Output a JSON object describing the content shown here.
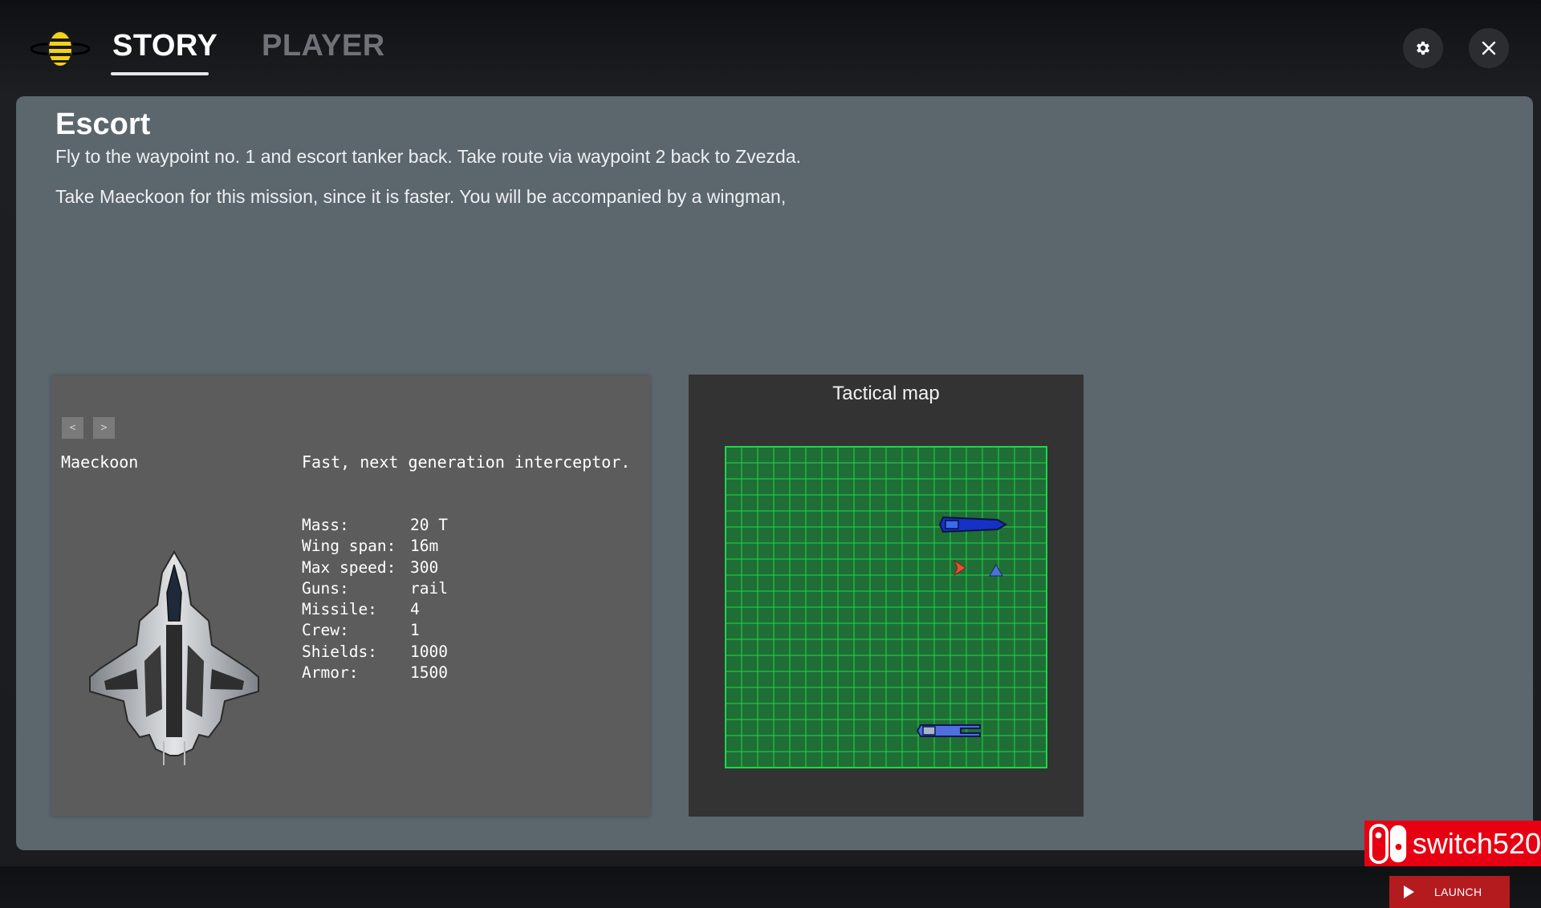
{
  "tabs": [
    {
      "label": "STORY",
      "active": true
    },
    {
      "label": "PLAYER",
      "active": false
    }
  ],
  "header": {
    "logo_icon": "bee-icon",
    "settings_icon": "gear-icon",
    "close_icon": "close-icon"
  },
  "mission": {
    "title": "Escort",
    "description_lines": [
      "Fly to the waypoint no. 1 and escort tanker back. Take route via waypoint 2 back to Zvezda.",
      "Take Maeckoon for this mission, since it is faster. You will be accompanied by a wingman,"
    ]
  },
  "ship": {
    "nav_prev": "<",
    "nav_next": ">",
    "name": "Maeckoon",
    "tagline": "Fast, next generation interceptor.",
    "stats": [
      {
        "label": "Mass:",
        "value": "20 T"
      },
      {
        "label": "Wing span:",
        "value": "16m"
      },
      {
        "label": "Max speed:",
        "value": "300"
      },
      {
        "label": "Guns:",
        "value": "rail"
      },
      {
        "label": "Missile:",
        "value": "4"
      },
      {
        "label": "Crew:",
        "value": "1"
      },
      {
        "label": "Shields:",
        "value": "1000"
      },
      {
        "label": "Armor:",
        "value": "1500"
      }
    ]
  },
  "tactical_map": {
    "title": "Tactical map",
    "grid_color": "#1fd64a",
    "background_color": "#1f6e35",
    "units": [
      {
        "type": "station",
        "color": "#1531c8"
      },
      {
        "type": "player-ship",
        "color": "#e8503c"
      },
      {
        "type": "wingman-ship",
        "color": "#4a73d8"
      },
      {
        "type": "tanker",
        "color": "#4f6ee0"
      }
    ]
  },
  "launch": {
    "label": "LAUNCH",
    "icon": "play-icon",
    "color": "#b31b1f"
  },
  "watermark": {
    "text": "switch520",
    "icon": "nintendo-switch-icon",
    "color": "#e60012"
  }
}
